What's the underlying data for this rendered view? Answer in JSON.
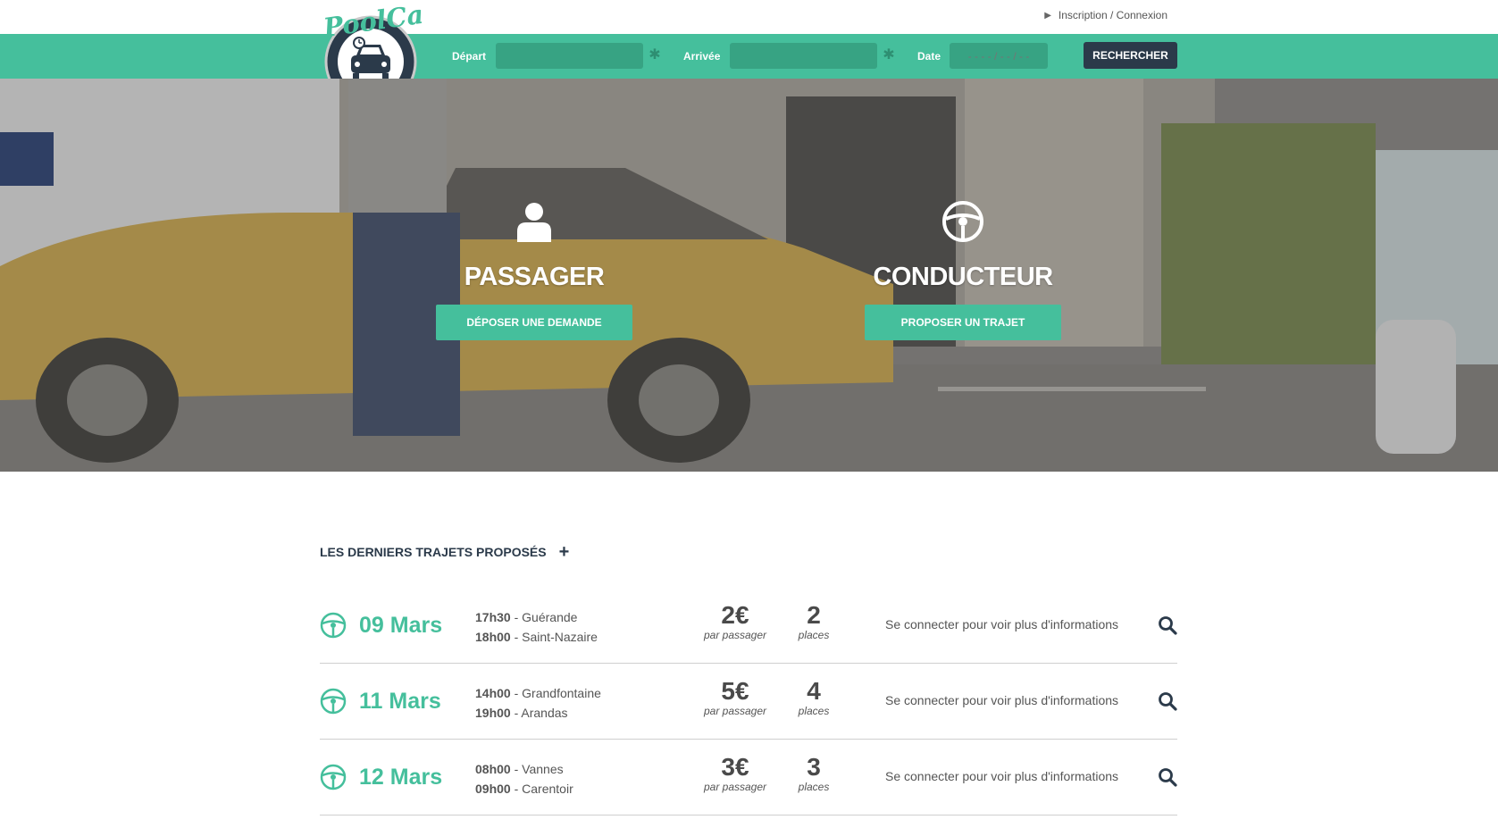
{
  "brand": {
    "logo_text": "PoolCar"
  },
  "header": {
    "auth_link": "Inscription / Connexion"
  },
  "search": {
    "depart_label": "Départ",
    "arrivee_label": "Arrivée",
    "date_label": "Date",
    "date_placeholder": "- - - - / - - / - -",
    "submit_label": "RECHERCHER"
  },
  "hero": {
    "passenger": {
      "title": "PASSAGER",
      "button": "DÉPOSER UNE DEMANDE"
    },
    "driver": {
      "title": "CONDUCTEUR",
      "button": "PROPOSER UN TRAJET"
    }
  },
  "trips_section": {
    "title": "LES DERNIERS TRAJETS PROPOSÉS",
    "plus": "+",
    "trips": [
      {
        "date": "09 Mars",
        "depart_time": "17h30",
        "depart_city": "Guérande",
        "arrival_time": "18h00",
        "arrival_city": "Saint-Nazaire",
        "price": "2€",
        "price_unit": "par passager",
        "places": "2",
        "places_unit": "places",
        "info": "Se connecter pour voir plus d'informations"
      },
      {
        "date": "11 Mars",
        "depart_time": "14h00",
        "depart_city": "Grandfontaine",
        "arrival_time": "19h00",
        "arrival_city": "Arandas",
        "price": "5€",
        "price_unit": "par passager",
        "places": "4",
        "places_unit": "places",
        "info": "Se connecter pour voir plus d'informations"
      },
      {
        "date": "12 Mars",
        "depart_time": "08h00",
        "depart_city": "Vannes",
        "arrival_time": "09h00",
        "arrival_city": "Carentoir",
        "price": "3€",
        "price_unit": "par passager",
        "places": "3",
        "places_unit": "places",
        "info": "Se connecter pour voir plus d'informations"
      }
    ]
  },
  "colors": {
    "accent": "#45bf9c",
    "accent_dark": "#37a383",
    "navy": "#2b3a4a"
  },
  "icons": {
    "passenger": "user-icon",
    "driver": "steering-wheel-icon",
    "search": "magnifier-icon",
    "settings": "gear-icon"
  }
}
